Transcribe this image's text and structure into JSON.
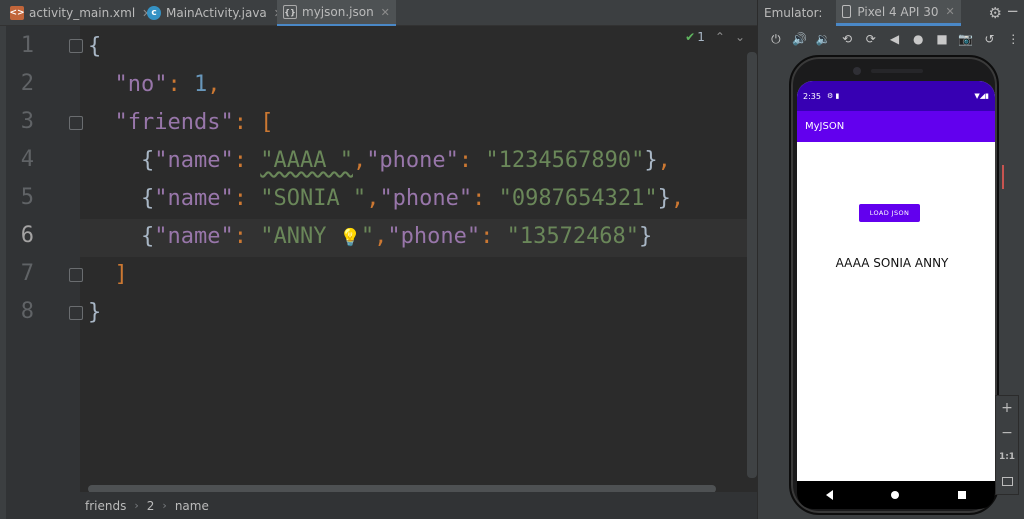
{
  "tabs": [
    {
      "label": "activity_main.xml",
      "icon": "xml-file-icon",
      "active": false
    },
    {
      "label": "MainActivity.java",
      "icon": "java-class-icon",
      "active": false
    },
    {
      "label": "myjson.json",
      "icon": "json-file-icon",
      "active": true
    }
  ],
  "inspection": {
    "count": "1"
  },
  "editor": {
    "line_numbers": [
      "1",
      "2",
      "3",
      "4",
      "5",
      "6",
      "7",
      "8"
    ],
    "current_line": "6",
    "code": {
      "open_brace": "{",
      "no_key": "\"no\"",
      "colon": ": ",
      "no_value": "1",
      "comma": ",",
      "friends_key": "\"friends\"",
      "open_bracket": "[",
      "close_bracket": "]",
      "close_brace": "}",
      "name_key": "\"name\"",
      "phone_key": "\"phone\"",
      "friends": [
        {
          "name": "\"AAAA \"",
          "phone": "\"1234567890\"",
          "trailing": ","
        },
        {
          "name": "\"SONIA \"",
          "phone": "\"0987654321\"",
          "trailing": ","
        },
        {
          "name": "\"ANNY ",
          "phone": "\"13572468\"",
          "trailing": ""
        }
      ]
    }
  },
  "breadcrumb": [
    "friends",
    "2",
    "name"
  ],
  "emulator": {
    "label": "Emulator:",
    "device": "Pixel 4 API 30",
    "status_time": "2:35",
    "app_title": "MyJSON",
    "button_label": "LOAD JSON",
    "result_text": "AAAA SONIA ANNY",
    "zoom_ratio": "1:1",
    "zoom_in": "+",
    "zoom_out": "−"
  }
}
